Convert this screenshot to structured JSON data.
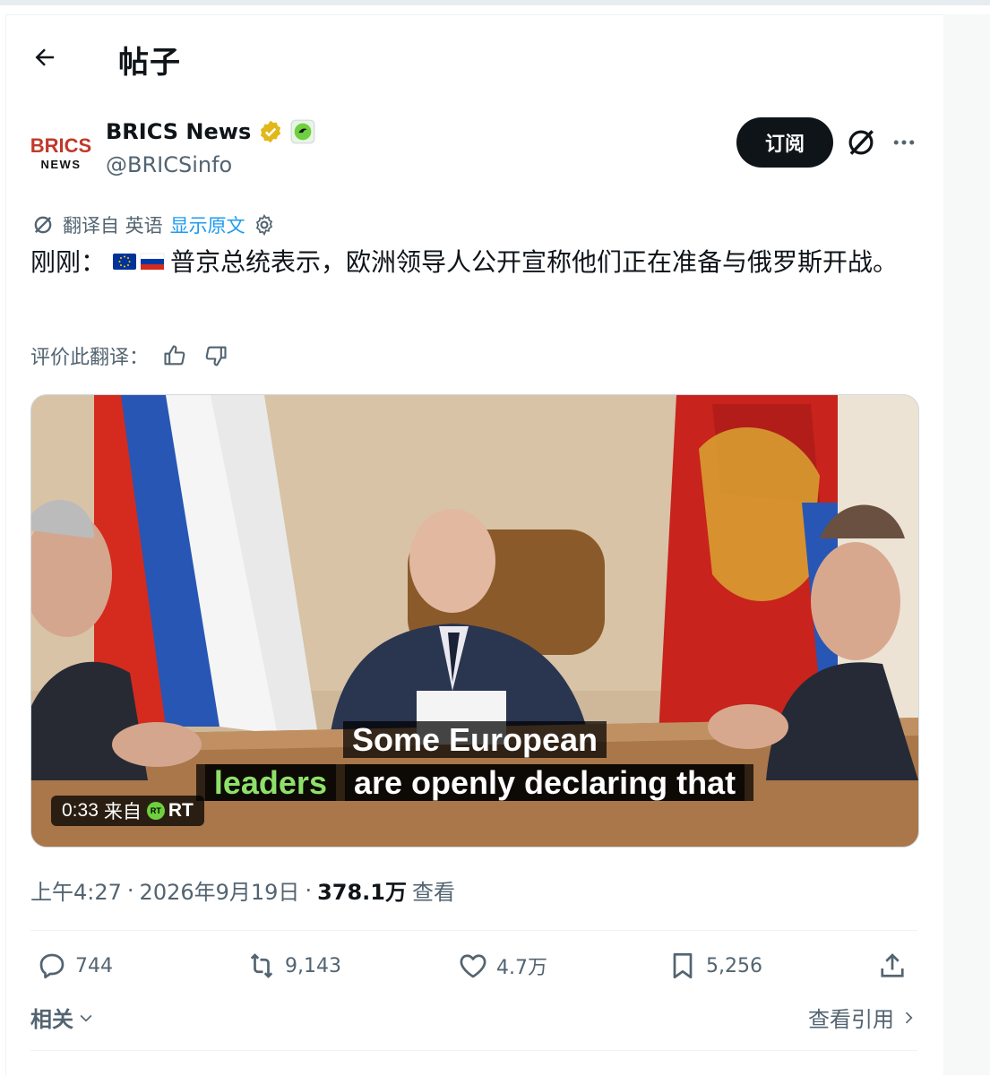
{
  "header": {
    "title": "帖子"
  },
  "author": {
    "display_name": "BRICS News",
    "handle": "@BRICSinfo",
    "avatar_text_top": "BRICS",
    "avatar_text_bottom": "NEWS"
  },
  "actions_top": {
    "subscribe_label": "订阅"
  },
  "translation": {
    "label": "翻译自 英语",
    "show_original": "显示原文"
  },
  "post": {
    "prefix": "刚刚：",
    "text": "普京总统表示，欧洲领导人公开宣称他们正在准备与俄罗斯开战。"
  },
  "rating": {
    "label": "评价此翻译："
  },
  "media": {
    "caption_line1": "Some European",
    "caption_line2_highlight": "leaders",
    "caption_line2_rest": "are openly declaring that",
    "duration": "0:33",
    "source_prefix": "来自",
    "source_name": "RT"
  },
  "meta": {
    "time": "上午4:27",
    "date": "2026年9月19日",
    "views_count": "378.1万",
    "views_label": "查看"
  },
  "stats": {
    "replies": "744",
    "reposts": "9,143",
    "likes": "4.7万",
    "bookmarks": "5,256"
  },
  "footer": {
    "related_label": "相关",
    "quotes_label": "查看引用"
  },
  "colors": {
    "accent": "#1d9bf0",
    "text_primary": "#0f1419",
    "text_secondary": "#536471",
    "subscribe_bg": "#0f1419",
    "verified_gold": "#e2b719",
    "caption_highlight": "#8fe06a"
  }
}
